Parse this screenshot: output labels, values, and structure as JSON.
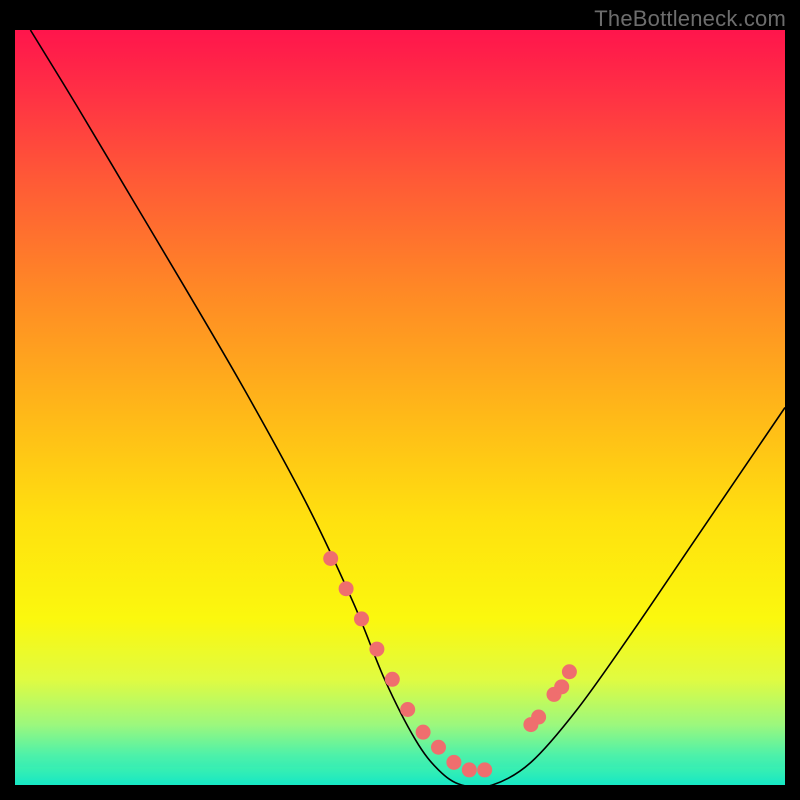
{
  "watermark": "TheBottleneck.com",
  "chart_data": {
    "type": "line",
    "title": "",
    "xlabel": "",
    "ylabel": "",
    "xlim": [
      0,
      100
    ],
    "ylim": [
      0,
      100
    ],
    "series": [
      {
        "name": "curve",
        "x": [
          2,
          8,
          15,
          22,
          30,
          38,
          44,
          48,
          52,
          55,
          58,
          62,
          67,
          73,
          80,
          88,
          96,
          100
        ],
        "y": [
          100,
          90,
          78,
          66,
          52,
          37,
          24,
          14,
          6,
          2,
          0,
          0,
          3,
          10,
          20,
          32,
          44,
          50
        ]
      }
    ],
    "dots": {
      "name": "highlight-dots",
      "x": [
        41,
        43,
        45,
        47,
        49,
        51,
        53,
        55,
        57,
        59,
        61,
        67,
        68,
        70,
        71,
        72
      ],
      "y": [
        30,
        26,
        22,
        18,
        14,
        10,
        7,
        5,
        3,
        2,
        2,
        8,
        9,
        12,
        13,
        15
      ]
    },
    "gradient_stops": [
      {
        "pos": 0.0,
        "color": "#ff154c"
      },
      {
        "pos": 0.08,
        "color": "#ff2f45"
      },
      {
        "pos": 0.2,
        "color": "#ff5a36"
      },
      {
        "pos": 0.35,
        "color": "#ff8a25"
      },
      {
        "pos": 0.5,
        "color": "#ffb619"
      },
      {
        "pos": 0.65,
        "color": "#ffe10f"
      },
      {
        "pos": 0.78,
        "color": "#fbf80e"
      },
      {
        "pos": 0.86,
        "color": "#e0fb41"
      },
      {
        "pos": 0.92,
        "color": "#9cf87d"
      },
      {
        "pos": 0.96,
        "color": "#4ef1a9"
      },
      {
        "pos": 1.0,
        "color": "#18e9c1"
      }
    ]
  }
}
